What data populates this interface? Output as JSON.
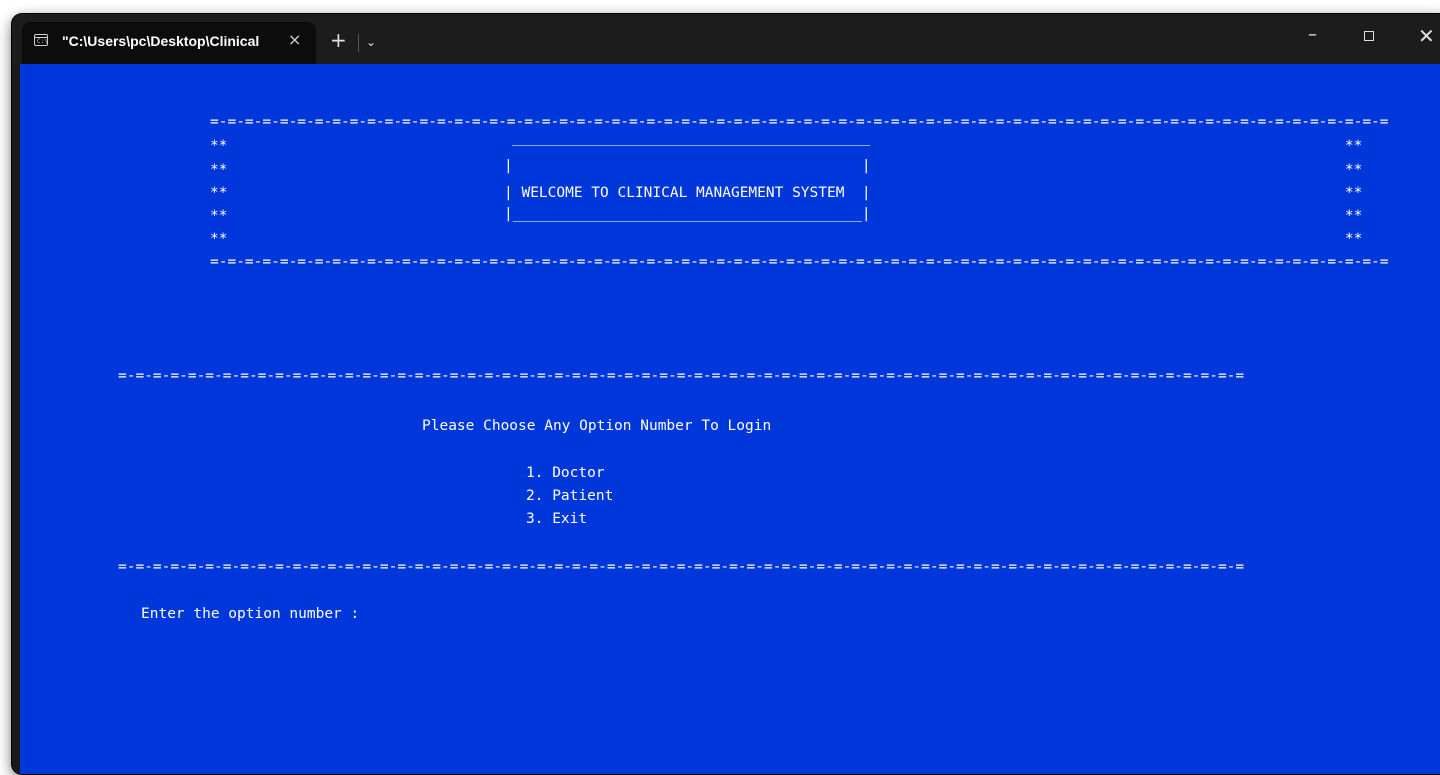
{
  "window": {
    "tab_title": "\"C:\\Users\\pc\\Desktop\\Clinical",
    "tab_close": "×",
    "new_tab": "+",
    "dropdown": "⌄",
    "minimize": "–",
    "close": "✕",
    "terminal_icon_text": "C:\\"
  },
  "console": {
    "banner": {
      "border_top": "=-=-=-=-=-=-=-=-=-=-=-=-=-=-=-=-=-=-=-=-=-=-=-=-=-=-=-=-=-=-=-=-=-=-=-=-=-=-=-=-=-=-=-=-=-=-=-=-=-=-=-=-=-=-=-=-=-=-=-=-=-=-=-=-=-=-=-=",
      "row_1": "**                                                                                                                                **",
      "box_top": "_________________________________________",
      "row_2": "**                                                                                                                                **",
      "box_side": "|                                        |",
      "row_3": "**                                                                                                                                **",
      "welcome": "| WELCOME TO CLINICAL MANAGEMENT SYSTEM  |",
      "row_4": "**                                                                                                                                **",
      "box_bottom": "|________________________________________|",
      "row_5": "**                                                                                                                                **",
      "border_bottom": "=-=-=-=-=-=-=-=-=-=-=-=-=-=-=-=-=-=-=-=-=-=-=-=-=-=-=-=-=-=-=-=-=-=-=-=-=-=-=-=-=-=-=-=-=-=-=-=-=-=-=-=-=-=-=-=-=-=-=-=-=-=-=-=-=-=-=-="
    },
    "menu": {
      "divider_top": "=-=-=-=-=-=-=-=-=-=-=-=-=-=-=-=-=-=-=-=-=-=-=-=-=-=-=-=-=-=-=-=-=-=-=-=-=-=-=-=-=-=-=-=-=-=-=-=-=-=-=-=-=-=-=-=-=-=-=-=-=-=-=-=-=",
      "prompt": "Please Choose Any Option Number To Login",
      "options": [
        "1. Doctor",
        "2. Patient",
        "3. Exit"
      ],
      "divider_bottom": "=-=-=-=-=-=-=-=-=-=-=-=-=-=-=-=-=-=-=-=-=-=-=-=-=-=-=-=-=-=-=-=-=-=-=-=-=-=-=-=-=-=-=-=-=-=-=-=-=-=-=-=-=-=-=-=-=-=-=-=-=-=-=-=-=",
      "input_label": "Enter the option number :"
    }
  }
}
